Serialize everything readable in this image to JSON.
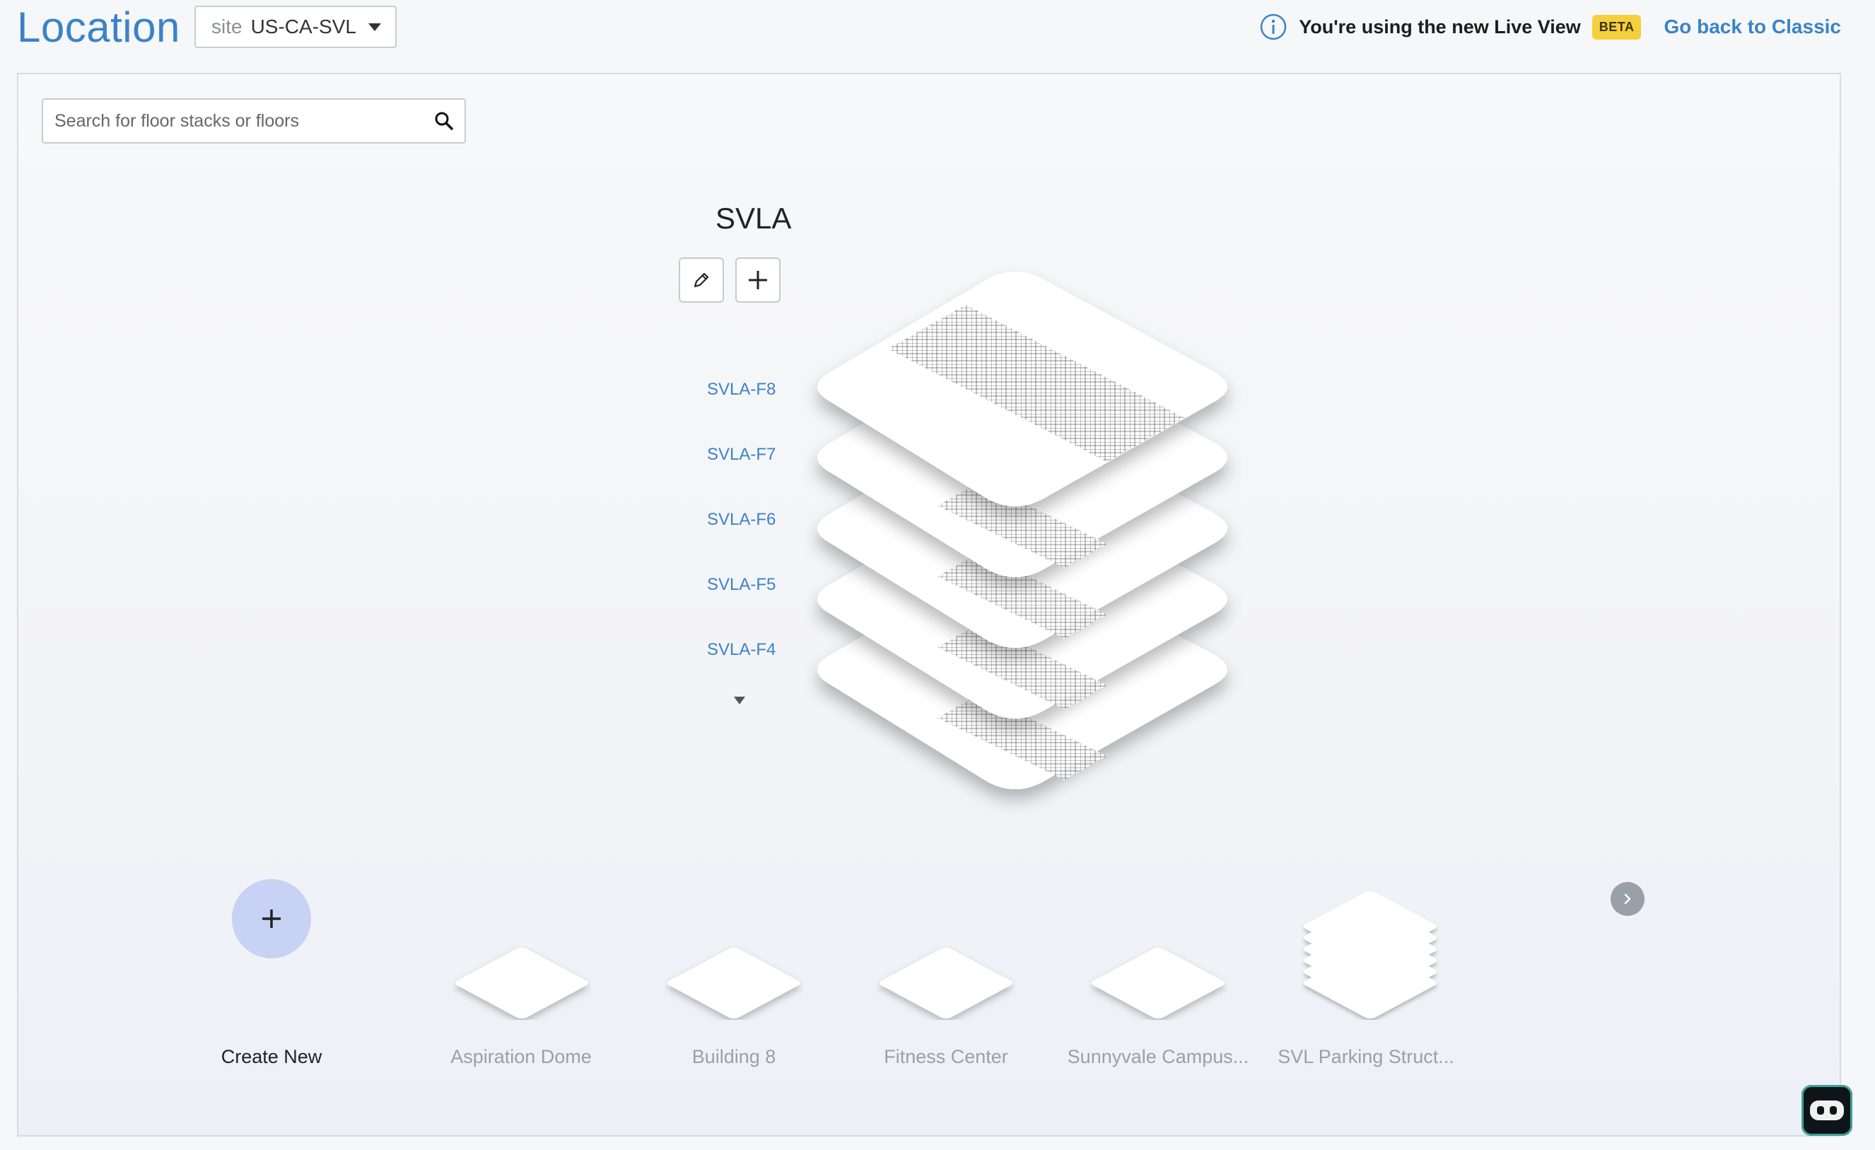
{
  "header": {
    "title": "Location",
    "site_prefix": "site",
    "site_value": "US-CA-SVL",
    "notice_text": "You're using the new Live View",
    "beta_label": "BETA",
    "go_back_label": "Go back to Classic"
  },
  "search": {
    "placeholder": "Search for floor stacks or floors"
  },
  "stack": {
    "name": "SVLA",
    "floors": [
      "SVLA-F8",
      "SVLA-F7",
      "SVLA-F6",
      "SVLA-F5",
      "SVLA-F4"
    ]
  },
  "carousel": {
    "create_label": "Create New",
    "items": [
      {
        "label": "Aspiration Dome"
      },
      {
        "label": "Building 8"
      },
      {
        "label": "Fitness Center"
      },
      {
        "label": "Sunnyvale Campus..."
      },
      {
        "label": "SVL Parking Struct..."
      }
    ]
  },
  "icons": {
    "info": "info-icon",
    "search": "search-icon",
    "edit": "pencil-icon",
    "add": "plus-icon",
    "next": "chevron-right-icon",
    "bot": "chatbot-icon"
  },
  "colors": {
    "accent": "#3a83c9",
    "beta_badge": "#f6cf3c",
    "create_circle": "#c7d2f4",
    "inactive_label": "#9aa0a8"
  }
}
